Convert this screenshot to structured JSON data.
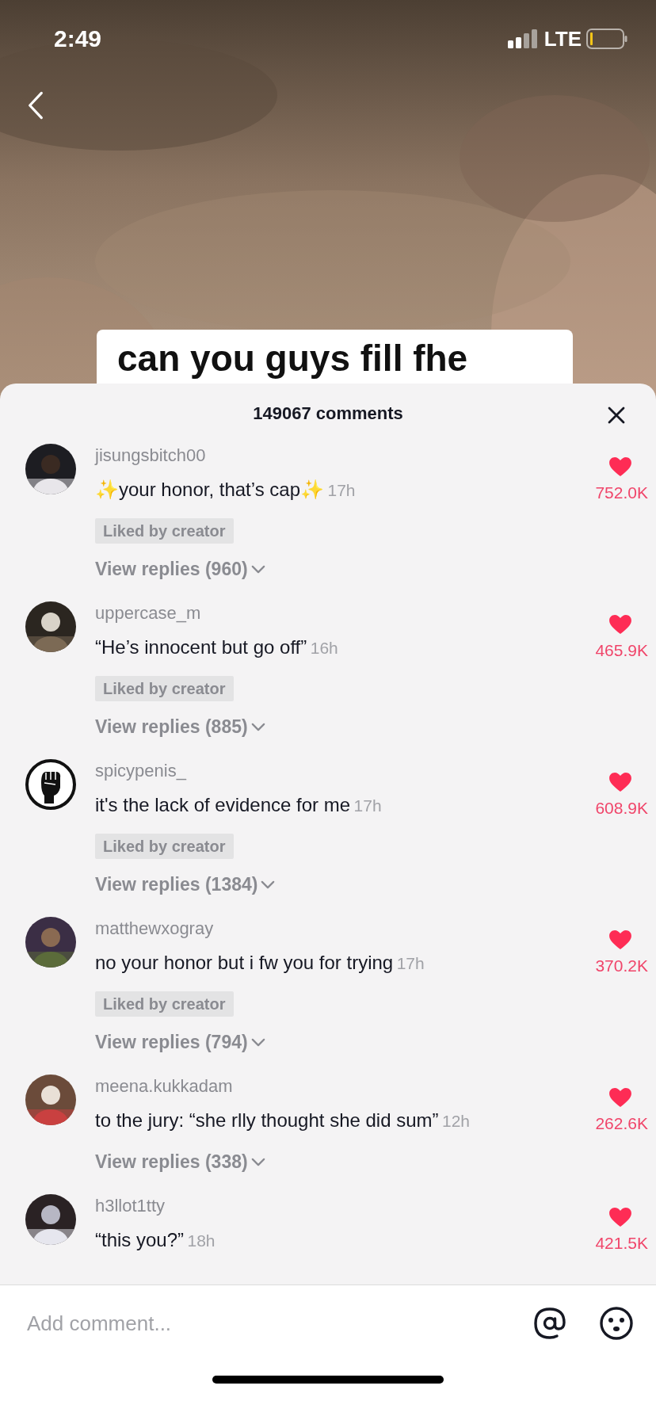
{
  "status_bar": {
    "time": "2:49",
    "network": "LTE"
  },
  "video": {
    "kind": "picture",
    "caption": "can you guys fill fhe"
  },
  "comments_sheet": {
    "title": "149067 comments",
    "comments": [
      {
        "username": "jisungsbitch00",
        "text": "✨your honor, that’s cap✨",
        "time": "17h",
        "badge": "Liked by creator",
        "view_replies": "View replies (960)",
        "liked": true,
        "likes": "752.0K"
      },
      {
        "username": "uppercase_m",
        "text": "“He’s innocent but go off”",
        "time": "16h",
        "badge": "Liked by creator",
        "view_replies": "View replies (885)",
        "liked": true,
        "likes": "465.9K"
      },
      {
        "username": "spicypenis_",
        "avatar": {
          "kind": "fist"
        },
        "text": "it's the lack of evidence for me",
        "time": "17h",
        "badge": "Liked by creator",
        "view_replies": "View replies (1384)",
        "liked": true,
        "likes": "608.9K"
      },
      {
        "username": "matthewxogray",
        "text": "no your honor but i fw you for trying",
        "time": "17h",
        "badge": "Liked by creator",
        "view_replies": "View replies (794)",
        "liked": true,
        "likes": "370.2K"
      },
      {
        "username": "meena.kukkadam",
        "text": "to the jury: “she rlly thought she did sum”",
        "time": "12h",
        "view_replies": "View replies (338)",
        "liked": true,
        "likes": "262.6K"
      },
      {
        "username": "h3llot1tty",
        "text": "“this you?”",
        "time": "18h",
        "liked": true,
        "likes": "421.5K"
      }
    ]
  },
  "input": {
    "placeholder": "Add comment..."
  }
}
